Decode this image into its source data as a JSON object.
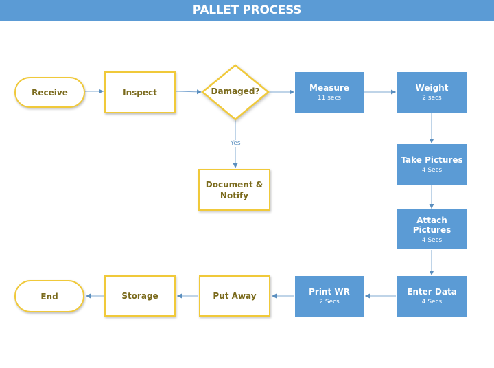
{
  "header": {
    "title": "PALLET PROCESS"
  },
  "colors": {
    "header": "#5b9bd5",
    "process_blue": "#5b9bd5",
    "outline_yellow": "#f0c93a",
    "text_olive": "#7a6a1c",
    "connector": "#6f9fcc"
  },
  "nodes": {
    "receive": {
      "label": "Receive",
      "shape": "terminator"
    },
    "inspect": {
      "label": "Inspect",
      "shape": "process"
    },
    "damaged": {
      "label": "Damaged?",
      "shape": "decision"
    },
    "document": {
      "label": "Document & Notify",
      "line1": "Document &",
      "line2": "Notify",
      "shape": "process"
    },
    "measure": {
      "label": "Measure",
      "time": "11 secs",
      "shape": "process"
    },
    "weight": {
      "label": "Weight",
      "time": "2 secs",
      "shape": "process"
    },
    "take_pictures": {
      "label": "Take Pictures",
      "time": "4 Secs",
      "shape": "process"
    },
    "attach_pictures": {
      "label": "Attach Pictures",
      "time": "4 Secs",
      "shape": "process"
    },
    "enter_data": {
      "label": "Enter Data",
      "time": "4 Secs",
      "shape": "process"
    },
    "print_wr": {
      "label": "Print WR",
      "time": "2 Secs",
      "shape": "process"
    },
    "put_away": {
      "label": "Put Away",
      "shape": "process"
    },
    "storage": {
      "label": "Storage",
      "shape": "process"
    },
    "end": {
      "label": "End",
      "shape": "terminator"
    }
  },
  "edges": [
    {
      "from": "receive",
      "to": "inspect"
    },
    {
      "from": "inspect",
      "to": "damaged"
    },
    {
      "from": "damaged",
      "to": "measure"
    },
    {
      "from": "damaged",
      "to": "document",
      "label": "Yes"
    },
    {
      "from": "measure",
      "to": "weight"
    },
    {
      "from": "weight",
      "to": "take_pictures"
    },
    {
      "from": "take_pictures",
      "to": "attach_pictures"
    },
    {
      "from": "attach_pictures",
      "to": "enter_data"
    },
    {
      "from": "enter_data",
      "to": "print_wr"
    },
    {
      "from": "print_wr",
      "to": "put_away"
    },
    {
      "from": "put_away",
      "to": "storage"
    },
    {
      "from": "storage",
      "to": "end"
    }
  ]
}
